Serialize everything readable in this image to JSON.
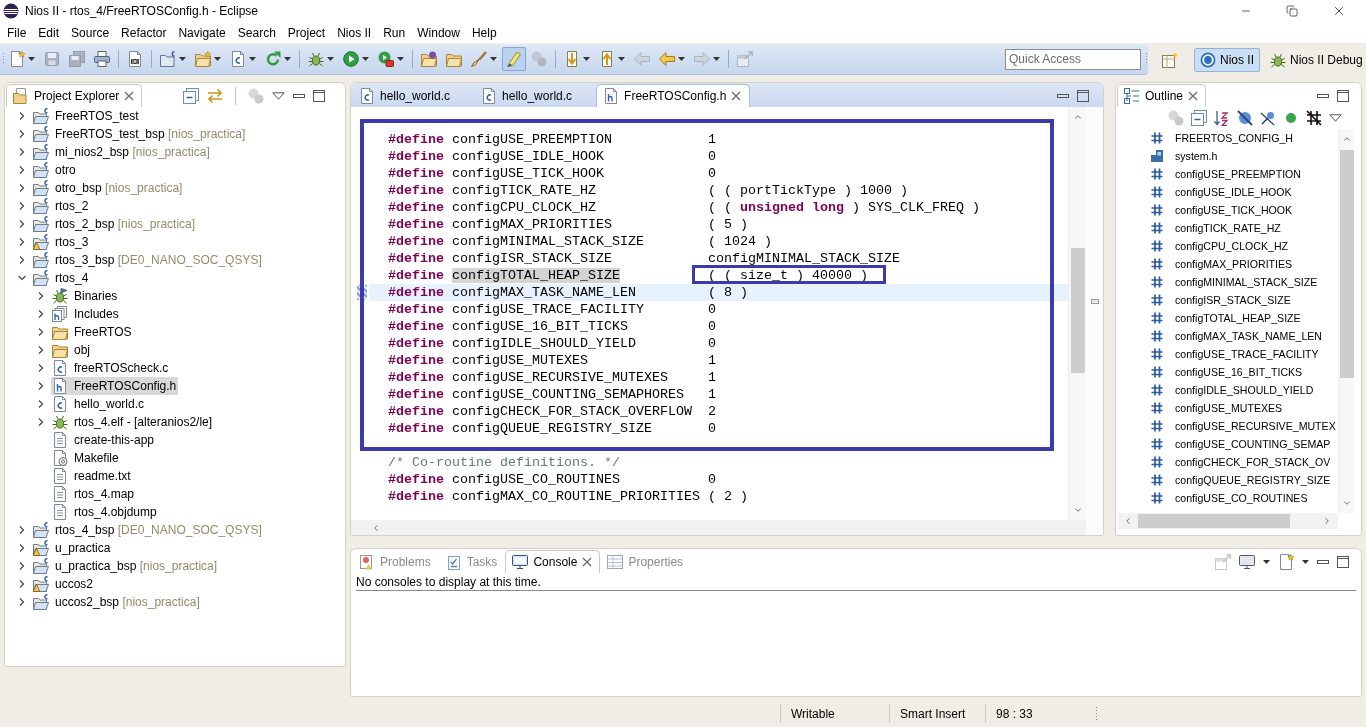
{
  "window": {
    "title": "Nios II - rtos_4/FreeRTOSConfig.h - Eclipse"
  },
  "menu": [
    "File",
    "Edit",
    "Source",
    "Refactor",
    "Navigate",
    "Search",
    "Project",
    "Nios II",
    "Run",
    "Window",
    "Help"
  ],
  "toolbar": {
    "groups": [
      [
        {
          "kind": "dropdown",
          "disabled": false,
          "selected": false
        },
        {
          "kind": "button",
          "disabled": true,
          "selected": false
        },
        {
          "kind": "button",
          "disabled": true,
          "selected": false
        },
        {
          "kind": "button",
          "disabled": false,
          "selected": false
        }
      ],
      [
        {
          "kind": "button",
          "disabled": false,
          "selected": false
        }
      ],
      [
        {
          "kind": "dropdown",
          "disabled": false,
          "selected": false
        },
        {
          "kind": "dropdown",
          "disabled": false,
          "selected": false
        },
        {
          "kind": "dropdown",
          "disabled": false,
          "selected": false
        },
        {
          "kind": "dropdown",
          "disabled": false,
          "selected": false
        }
      ],
      [
        {
          "kind": "dropdown",
          "disabled": false,
          "selected": false
        },
        {
          "kind": "dropdown",
          "disabled": false,
          "selected": false
        },
        {
          "kind": "dropdown",
          "disabled": false,
          "selected": false
        }
      ],
      [
        {
          "kind": "button",
          "disabled": false,
          "selected": false
        },
        {
          "kind": "button",
          "disabled": false,
          "selected": false
        },
        {
          "kind": "dropdown",
          "disabled": false,
          "selected": false
        },
        {
          "kind": "button",
          "disabled": false,
          "selected": true
        },
        {
          "kind": "button",
          "disabled": true,
          "selected": false
        }
      ],
      [
        {
          "kind": "dropdown",
          "disabled": false,
          "selected": false
        },
        {
          "kind": "dropdown",
          "disabled": false,
          "selected": false
        },
        {
          "kind": "button",
          "disabled": true,
          "selected": false
        },
        {
          "kind": "dropdown",
          "disabled": false,
          "selected": false
        },
        {
          "kind": "dropdown",
          "disabled": true,
          "selected": false
        }
      ],
      [
        {
          "kind": "button",
          "disabled": true,
          "selected": false
        }
      ]
    ],
    "quick_access": {
      "placeholder": "Quick Access"
    },
    "perspectives": [
      {
        "label": "Nios II",
        "selected": true
      },
      {
        "label": "Nios II Debug",
        "selected": false
      }
    ]
  },
  "project_explorer": {
    "title": "Project Explorer",
    "items": [
      {
        "label": "FreeRTOS_test",
        "kind": "project",
        "warning": false,
        "expanded": false,
        "selected": false
      },
      {
        "label": "FreeRTOS_test_bsp",
        "suffix": "[nios_practica]",
        "kind": "project",
        "warning": false,
        "expanded": false,
        "selected": false
      },
      {
        "label": "mi_nios2_bsp",
        "suffix": "[nios_practica]",
        "kind": "project",
        "warning": false,
        "expanded": false,
        "selected": false
      },
      {
        "label": "otro",
        "kind": "project",
        "warning": false,
        "expanded": false,
        "selected": false
      },
      {
        "label": "otro_bsp",
        "suffix": "[nios_practica]",
        "kind": "project",
        "warning": false,
        "expanded": false,
        "selected": false
      },
      {
        "label": "rtos_2",
        "kind": "project",
        "warning": false,
        "expanded": false,
        "selected": false
      },
      {
        "label": "rtos_2_bsp",
        "suffix": "[nios_practica]",
        "kind": "project",
        "warning": false,
        "expanded": false,
        "selected": false
      },
      {
        "label": "rtos_3",
        "kind": "project",
        "warning": true,
        "expanded": false,
        "selected": false
      },
      {
        "label": "rtos_3_bsp",
        "suffix": "[DE0_NANO_SOC_QSYS]",
        "kind": "project",
        "warning": false,
        "expanded": false,
        "selected": false
      },
      {
        "label": "rtos_4",
        "kind": "project",
        "warning": false,
        "expanded": true,
        "selected": false,
        "children": [
          {
            "label": "Binaries",
            "kind": "binaries",
            "expanded": false,
            "selected": false
          },
          {
            "label": "Includes",
            "kind": "includes",
            "expanded": false,
            "selected": false
          },
          {
            "label": "FreeRTOS",
            "kind": "folder",
            "expanded": false,
            "selected": false
          },
          {
            "label": "obj",
            "kind": "folder",
            "expanded": false,
            "selected": false
          },
          {
            "label": "freeRTOScheck.c",
            "kind": "c_file",
            "expanded": false,
            "selected": false
          },
          {
            "label": "FreeRTOSConfig.h",
            "kind": "h_file",
            "expanded": false,
            "selected": true
          },
          {
            "label": "hello_world.c",
            "kind": "c_file",
            "expanded": false,
            "selected": false
          },
          {
            "label": "rtos_4.elf - [alteranios2/le]",
            "kind": "elf",
            "expanded": false,
            "selected": false
          },
          {
            "label": "create-this-app",
            "kind": "text_file",
            "selected": false
          },
          {
            "label": "Makefile",
            "kind": "makefile",
            "selected": false
          },
          {
            "label": "readme.txt",
            "kind": "text_file",
            "selected": false
          },
          {
            "label": "rtos_4.map",
            "kind": "text_file",
            "selected": false
          },
          {
            "label": "rtos_4.objdump",
            "kind": "text_file",
            "selected": false
          }
        ]
      },
      {
        "label": "rtos_4_bsp",
        "suffix": "[DE0_NANO_SOC_QSYS]",
        "kind": "project",
        "warning": false,
        "expanded": false,
        "selected": false
      },
      {
        "label": "u_practica",
        "kind": "project",
        "warning": true,
        "expanded": false,
        "selected": false
      },
      {
        "label": "u_practica_bsp",
        "suffix": "[nios_practica]",
        "kind": "project",
        "warning": false,
        "expanded": false,
        "selected": false
      },
      {
        "label": "uccos2",
        "kind": "project",
        "warning": true,
        "expanded": false,
        "selected": false
      },
      {
        "label": "uccos2_bsp",
        "suffix": "[nios_practica]",
        "kind": "project",
        "warning": false,
        "expanded": false,
        "selected": false
      }
    ]
  },
  "editor": {
    "tabs": [
      {
        "label": "hello_world.c",
        "kind": "c_file",
        "selected": false
      },
      {
        "label": "hello_world.c",
        "kind": "c_file",
        "selected": false
      },
      {
        "label": "FreeRTOSConfig.h",
        "kind": "h_file",
        "selected": true
      }
    ],
    "code": [
      {
        "framed": true,
        "lines": [
          {
            "kind": "define",
            "directive": "#define",
            "name": "configUSE_PREEMPTION",
            "value": "1",
            "current": false,
            "marked": false,
            "boxed": false
          },
          {
            "kind": "define",
            "directive": "#define",
            "name": "configUSE_IDLE_HOOK",
            "value": "0",
            "current": false,
            "marked": false,
            "boxed": false
          },
          {
            "kind": "define",
            "directive": "#define",
            "name": "configUSE_TICK_HOOK",
            "value": "0",
            "current": false,
            "marked": false,
            "boxed": false
          },
          {
            "kind": "define",
            "directive": "#define",
            "name": "configTICK_RATE_HZ",
            "value": "( ( portTickType ) 1000 )",
            "current": false,
            "marked": false,
            "boxed": false
          },
          {
            "kind": "define",
            "directive": "#define",
            "name": "configCPU_CLOCK_HZ",
            "value": "( ( **unsigned long** ) SYS_CLK_FREQ )",
            "current": false,
            "marked": false,
            "boxed": false
          },
          {
            "kind": "define",
            "directive": "#define",
            "name": "configMAX_PRIORITIES",
            "value": "( 5 )",
            "current": false,
            "marked": false,
            "boxed": false
          },
          {
            "kind": "define",
            "directive": "#define",
            "name": "configMINIMAL_STACK_SIZE",
            "value": "( 1024 )",
            "current": false,
            "marked": false,
            "boxed": false
          },
          {
            "kind": "define",
            "directive": "#define",
            "name": "configISR_STACK_SIZE",
            "value": "configMINIMAL_STACK_SIZE",
            "current": false,
            "marked": false,
            "boxed": false
          },
          {
            "kind": "define",
            "directive": "#define",
            "name": "configTOTAL_HEAP_SIZE",
            "value": "( ( size_t ) 40000 )",
            "current": false,
            "marked": true,
            "boxed": true
          },
          {
            "kind": "define",
            "directive": "#define",
            "name": "configMAX_TASK_NAME_LEN",
            "value": "( 8 )",
            "current": true,
            "marked": false,
            "boxed": false
          },
          {
            "kind": "define",
            "directive": "#define",
            "name": "configUSE_TRACE_FACILITY",
            "value": "0",
            "current": false,
            "marked": false,
            "boxed": false
          },
          {
            "kind": "define",
            "directive": "#define",
            "name": "configUSE_16_BIT_TICKS",
            "value": "0",
            "current": false,
            "marked": false,
            "boxed": false
          },
          {
            "kind": "define",
            "directive": "#define",
            "name": "configIDLE_SHOULD_YIELD",
            "value": "0",
            "current": false,
            "marked": false,
            "boxed": false
          },
          {
            "kind": "define",
            "directive": "#define",
            "name": "configUSE_MUTEXES",
            "value": "1",
            "current": false,
            "marked": false,
            "boxed": false
          },
          {
            "kind": "define",
            "directive": "#define",
            "name": "configUSE_RECURSIVE_MUTEXES",
            "value": "1",
            "current": false,
            "marked": false,
            "boxed": false
          },
          {
            "kind": "define",
            "directive": "#define",
            "name": "configUSE_COUNTING_SEMAPHORES",
            "value": "1",
            "current": false,
            "marked": false,
            "boxed": false
          },
          {
            "kind": "define",
            "directive": "#define",
            "name": "configCHECK_FOR_STACK_OVERFLOW",
            "value": "2",
            "current": false,
            "marked": false,
            "boxed": false
          },
          {
            "kind": "define",
            "directive": "#define",
            "name": "configQUEUE_REGISTRY_SIZE",
            "value": "0",
            "current": false,
            "marked": false,
            "boxed": false
          }
        ]
      },
      {
        "framed": false,
        "lines": [
          {
            "kind": "comment",
            "text": "/* Co-routine definitions. */",
            "current": false
          },
          {
            "kind": "define",
            "directive": "#define",
            "name": "configUSE_CO_ROUTINES",
            "value": "0",
            "current": false,
            "marked": false,
            "boxed": false
          },
          {
            "kind": "define",
            "directive": "#define",
            "name": "configMAX_CO_ROUTINE_PRIORITIES",
            "value": "( 2 )",
            "current": false,
            "marked": false,
            "boxed": false
          }
        ]
      }
    ]
  },
  "outline": {
    "title": "Outline",
    "items": [
      {
        "label": "FREERTOS_CONFIG_H",
        "kind": "macro"
      },
      {
        "label": "system.h",
        "kind": "include"
      },
      {
        "label": "configUSE_PREEMPTION",
        "kind": "macro"
      },
      {
        "label": "configUSE_IDLE_HOOK",
        "kind": "macro"
      },
      {
        "label": "configUSE_TICK_HOOK",
        "kind": "macro"
      },
      {
        "label": "configTICK_RATE_HZ",
        "kind": "macro"
      },
      {
        "label": "configCPU_CLOCK_HZ",
        "kind": "macro"
      },
      {
        "label": "configMAX_PRIORITIES",
        "kind": "macro"
      },
      {
        "label": "configMINIMAL_STACK_SIZE",
        "kind": "macro"
      },
      {
        "label": "configISR_STACK_SIZE",
        "kind": "macro"
      },
      {
        "label": "configTOTAL_HEAP_SIZE",
        "kind": "macro"
      },
      {
        "label": "configMAX_TASK_NAME_LEN",
        "kind": "macro"
      },
      {
        "label": "configUSE_TRACE_FACILITY",
        "kind": "macro"
      },
      {
        "label": "configUSE_16_BIT_TICKS",
        "kind": "macro"
      },
      {
        "label": "configIDLE_SHOULD_YIELD",
        "kind": "macro"
      },
      {
        "label": "configUSE_MUTEXES",
        "kind": "macro"
      },
      {
        "label": "configUSE_RECURSIVE_MUTEX",
        "kind": "macro"
      },
      {
        "label": "configUSE_COUNTING_SEMAP",
        "kind": "macro"
      },
      {
        "label": "configCHECK_FOR_STACK_OV",
        "kind": "macro"
      },
      {
        "label": "configQUEUE_REGISTRY_SIZE",
        "kind": "macro"
      },
      {
        "label": "configUSE_CO_ROUTINES",
        "kind": "macro"
      }
    ]
  },
  "console": {
    "tabs": [
      {
        "label": "Problems",
        "kind": "problems",
        "selected": false
      },
      {
        "label": "Tasks",
        "kind": "tasks",
        "selected": false
      },
      {
        "label": "Console",
        "kind": "console",
        "selected": true
      },
      {
        "label": "Properties",
        "kind": "properties",
        "selected": false
      }
    ],
    "message": "No consoles to display at this time."
  },
  "status_bar": [
    "Writable",
    "Smart Insert",
    "98 : 33"
  ]
}
